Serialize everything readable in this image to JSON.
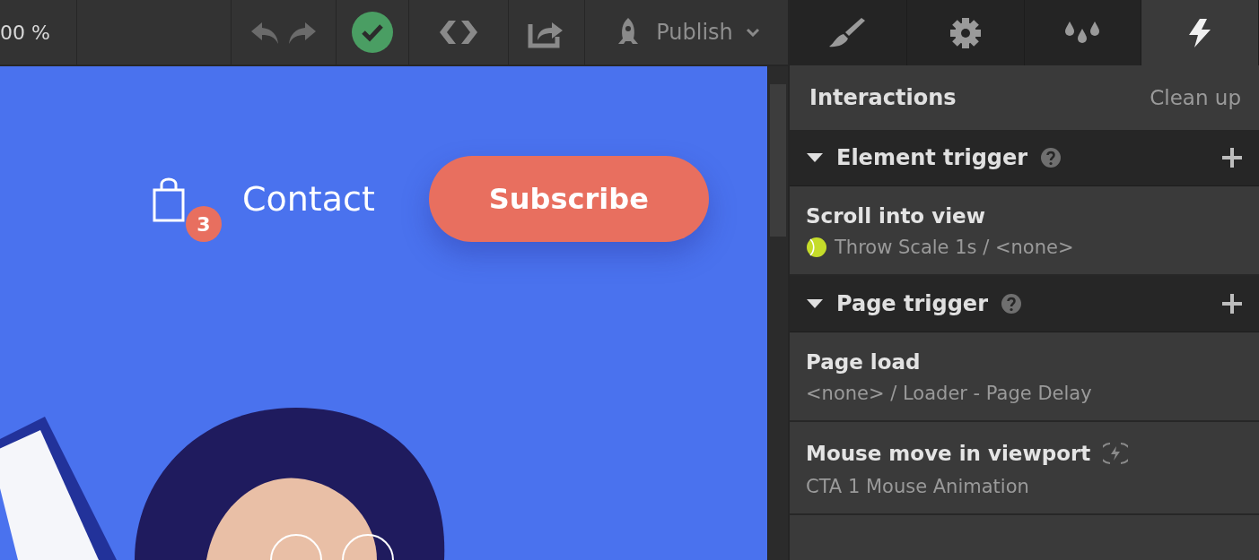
{
  "toolbar": {
    "zoom": "00 %",
    "publish": "Publish"
  },
  "panel_tabs": [
    {
      "kind": "brush",
      "selected": false
    },
    {
      "kind": "gear",
      "selected": false
    },
    {
      "kind": "drops",
      "selected": false
    },
    {
      "kind": "bolt",
      "selected": true
    }
  ],
  "panel": {
    "title": "Interactions",
    "action": "Clean up"
  },
  "sections": [
    {
      "title": "Element trigger",
      "expanded": true,
      "items": [
        {
          "name": "Scroll into view",
          "detail": "Throw Scale 1s / <none>",
          "kind": "ball"
        }
      ]
    },
    {
      "title": "Page trigger",
      "expanded": true,
      "items": [
        {
          "name": "Page load",
          "detail": "<none> / Loader - Page Delay",
          "kind": "plain"
        },
        {
          "name": "Mouse move in viewport",
          "detail": "CTA 1 Mouse Animation",
          "kind": "continuous"
        }
      ]
    }
  ],
  "canvas": {
    "cart_count": "3",
    "link": "Contact",
    "button": "Subscribe"
  }
}
